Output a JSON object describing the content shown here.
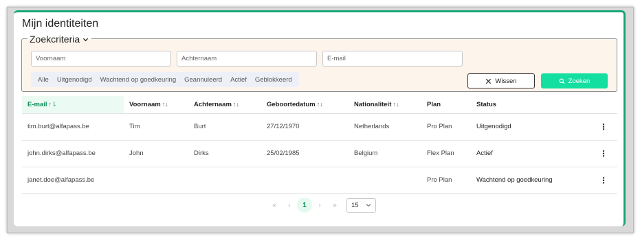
{
  "page": {
    "title": "Mijn identiteiten"
  },
  "criteria": {
    "legend": "Zoekcriteria",
    "first_name_placeholder": "Voornaam",
    "last_name_placeholder": "Achternaam",
    "email_placeholder": "E-mail",
    "filters": [
      "Alle",
      "Uitgenodigd",
      "Wachtend op goedkeuring",
      "Geannuleerd",
      "Actief",
      "Geblokkeerd"
    ],
    "clear_label": "Wissen",
    "search_label": "Zoeken"
  },
  "table": {
    "columns": [
      "E-mail",
      "Voornaam",
      "Achternaam",
      "Geboortedatum",
      "Nationaliteit",
      "Plan",
      "Status"
    ],
    "rows": [
      [
        "tim.burt@alfapass.be",
        "Tim",
        "Burt",
        "27/12/1970",
        "Netherlands",
        "Pro Plan",
        "Uitgenodigd"
      ],
      [
        "john.dirks@alfapass.be",
        "John",
        "Dirks",
        "25/02/1985",
        "Belgium",
        "Flex Plan",
        "Actief"
      ],
      [
        "janet.doe@alfapass.be",
        "",
        "",
        "",
        "",
        "Pro Plan",
        "Wachtend op goedkeuring"
      ]
    ],
    "row_menu_glyph": "⋮"
  },
  "pagination": {
    "first": "«",
    "prev": "‹",
    "current": "1",
    "next": "›",
    "last": "»",
    "page_size": "15"
  },
  "colors": {
    "accent": "#14dfa0",
    "accent_dark": "#0c8a59",
    "criteria_bg": "#fdf4ec"
  }
}
